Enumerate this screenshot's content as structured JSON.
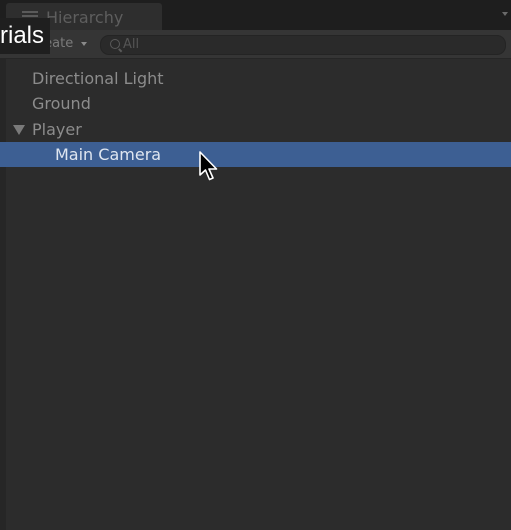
{
  "window": {
    "tab_label": "Hierarchy",
    "overlay_caption": "rials"
  },
  "toolbar": {
    "create_label": "Create",
    "search_placeholder": "All"
  },
  "tree": {
    "items": [
      {
        "label": "Directional Light",
        "depth": 0,
        "selected": false,
        "expanded": null
      },
      {
        "label": "Ground",
        "depth": 0,
        "selected": false,
        "expanded": null
      },
      {
        "label": "Player",
        "depth": 0,
        "selected": false,
        "expanded": true
      },
      {
        "label": "Main Camera",
        "depth": 1,
        "selected": true,
        "expanded": null
      }
    ]
  },
  "colors": {
    "panel_bg": "#2c2c2c",
    "selection": "#3d5f93",
    "text": "#8c8c8c",
    "selected_text": "#dfe6f0"
  },
  "icons": {
    "tab": "hierarchy-list-icon",
    "search": "search-icon",
    "foldout": "foldout-expanded-icon",
    "cursor": "mouse-pointer-icon"
  }
}
